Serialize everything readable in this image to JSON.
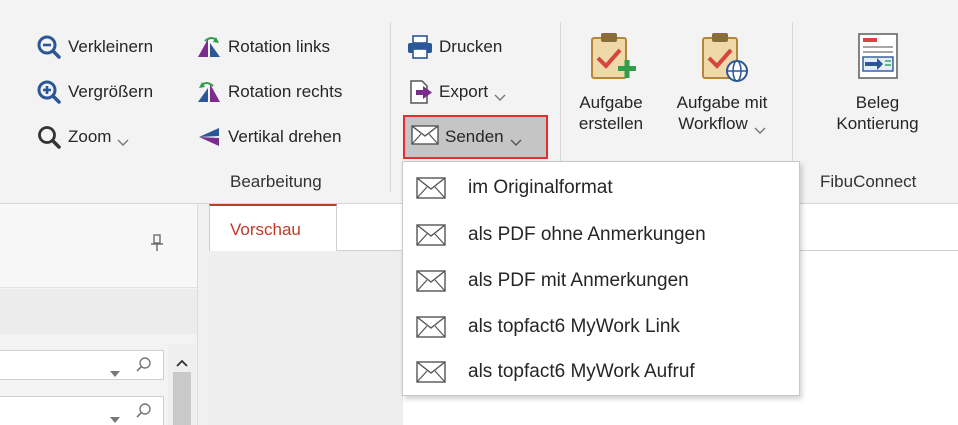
{
  "ribbon": {
    "view": {
      "zoom_out_label": "Verkleinern",
      "zoom_in_label": "Vergrößern",
      "zoom_label": "Zoom"
    },
    "edit": {
      "rotate_left_label": "Rotation links",
      "rotate_right_label": "Rotation rechts",
      "flip_vertical_label": "Vertikal drehen",
      "group_label": "Bearbeitung"
    },
    "output": {
      "print_label": "Drucken",
      "export_label": "Export",
      "send_label": "Senden"
    },
    "tasks": {
      "create_task_line1": "Aufgabe",
      "create_task_line2": "erstellen",
      "task_workflow_line1": "Aufgabe mit",
      "task_workflow_line2": "Workflow"
    },
    "fibu": {
      "beleg_line1": "Beleg",
      "beleg_line2": "Kontierung",
      "group_label": "FibuConnect"
    }
  },
  "send_menu": {
    "items": [
      {
        "label": "im Originalformat",
        "icon": "envelope-icon"
      },
      {
        "label": "als PDF ohne Anmerkungen",
        "icon": "envelope-icon"
      },
      {
        "label": "als PDF mit Anmerkungen",
        "icon": "envelope-icon"
      },
      {
        "label": "als topfact6 MyWork Link",
        "icon": "envelope-icon"
      },
      {
        "label": "als topfact6 MyWork Aufruf",
        "icon": "envelope-icon"
      }
    ]
  },
  "tabs": {
    "preview_label": "Vorschau"
  },
  "colors": {
    "accent_red": "#c0392b",
    "highlight_border": "#e52d2d",
    "icon_blue": "#2b5797",
    "icon_purple": "#7b2d8e",
    "icon_green": "#2e9e4a"
  }
}
